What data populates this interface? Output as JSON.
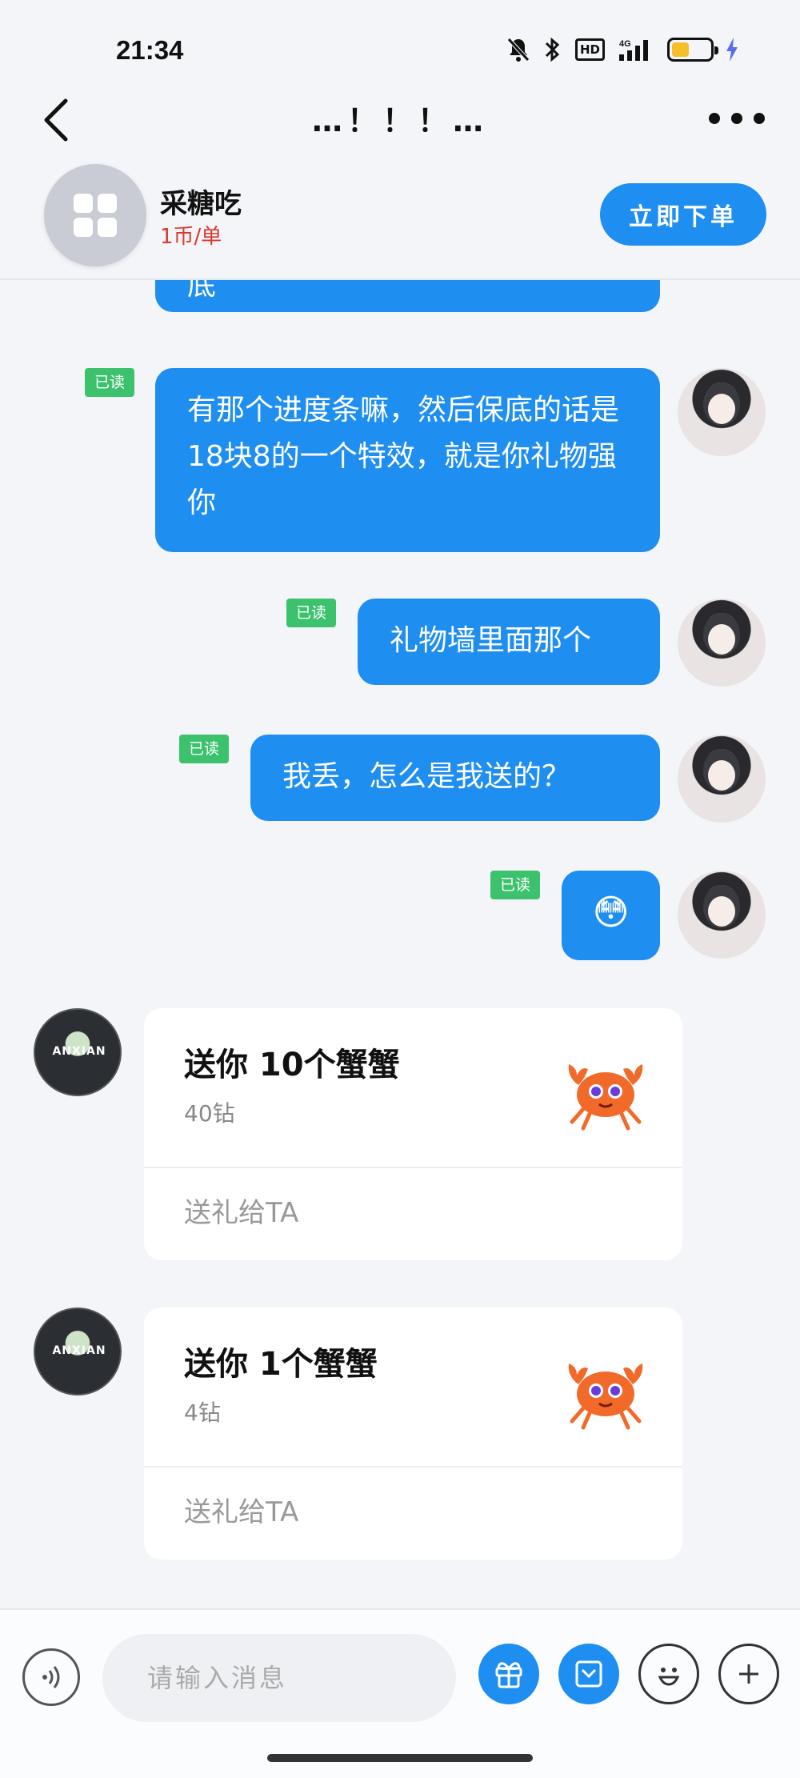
{
  "status_bar": {
    "time": "21:34",
    "hd_label": "HD",
    "network_label": "4G",
    "battery_color": "#f5bf2a"
  },
  "nav": {
    "title": "…！！！…"
  },
  "profile": {
    "name": "采糖吃",
    "price": "1币/单",
    "order_button": "立即下单"
  },
  "messages": [
    {
      "from": "me",
      "tag": "已读",
      "text": "有那个进度条嘛，然后保底的话是18块8的一个特效，就是你礼物强你"
    },
    {
      "from": "me",
      "tag": "已读",
      "text": "礼物墙里面那个"
    },
    {
      "from": "me",
      "tag": "已读",
      "text": "我丢，怎么是我送的？"
    },
    {
      "from": "me",
      "tag": "已读",
      "text": "😳"
    }
  ],
  "partial_bubble_text": "底",
  "gifts": [
    {
      "title": "送你 10个蟹蟹",
      "price": "40钻",
      "action": "送礼给TA",
      "icon": "crab-icon"
    },
    {
      "title": "送你 1个蟹蟹",
      "price": "4钻",
      "action": "送礼给TA",
      "icon": "crab-icon"
    }
  ],
  "other_avatar_text": "ANXIAN",
  "input": {
    "placeholder": "请输入消息"
  },
  "colors": {
    "accent": "#1f8ef1",
    "read_tag": "#3cc26d",
    "price_red": "#e0362c",
    "background": "#f3f5f8"
  }
}
